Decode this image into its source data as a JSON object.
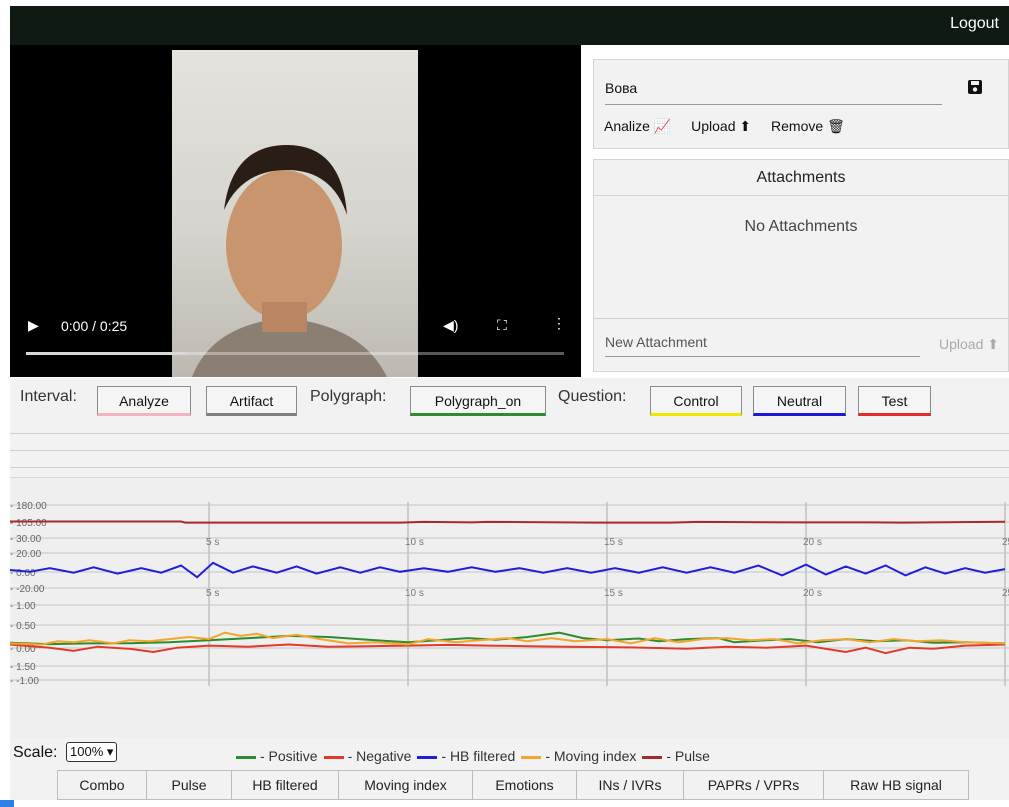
{
  "header": {
    "logout_label": "Logout"
  },
  "video": {
    "time": "0:00 / 0:25",
    "play_icon": "play-icon",
    "volume_icon": "volume-icon",
    "fullscreen_icon": "fullscreen-icon",
    "more_icon": "more-icon"
  },
  "record": {
    "name_value": "Вова",
    "analyze_label": "Analize",
    "upload_label": "Upload",
    "remove_label": "Remove"
  },
  "attachments": {
    "title": "Attachments",
    "empty_text": "No Attachments",
    "new_placeholder": "New Attachment",
    "upload_label": "Upload"
  },
  "toolbar": {
    "interval_label": "Interval:",
    "analyze_btn": "Analyze",
    "artifact_btn": "Artifact",
    "polygraph_label": "Polygraph:",
    "polygraph_btn": "Polygraph_on",
    "question_label": "Question:",
    "control_btn": "Control",
    "neutral_btn": "Neutral",
    "test_btn": "Test"
  },
  "colors": {
    "analyze": "#f3b3c0",
    "artifact": "#808080",
    "polygraph": "#2e8b2e",
    "control": "#f2e600",
    "neutral": "#1a1ad6",
    "test": "#e02b2b",
    "positive": "#2e8b2e",
    "negative": "#e23a2a",
    "hb": "#1f1fd8",
    "moving": "#f4a52a",
    "pulse": "#a52a2a"
  },
  "chart_data": {
    "type": "line",
    "x_ticks": [
      "5 s",
      "10 s",
      "15 s",
      "20 s",
      "25"
    ],
    "xlim": [
      0,
      25
    ],
    "panels": [
      {
        "name": "pulse",
        "y_ticks": [
          "180.00",
          "105.00",
          "30.00"
        ],
        "ylim": [
          30,
          180
        ],
        "series": [
          {
            "name": "Pulse",
            "color": "#a52a2a",
            "points": [
              [
                0,
                105
              ],
              [
                4.3,
                105
              ],
              [
                4.4,
                100
              ],
              [
                9.8,
                100
              ],
              [
                10.4,
                103
              ],
              [
                11.6,
                101
              ],
              [
                12,
                103
              ],
              [
                14.8,
                100
              ],
              [
                16.6,
                100
              ],
              [
                17.3,
                103
              ],
              [
                19.8,
                101
              ],
              [
                21.6,
                101
              ],
              [
                22.4,
                100
              ],
              [
                25,
                104
              ]
            ]
          }
        ]
      },
      {
        "name": "hb",
        "y_ticks": [
          "20.00",
          "0.00",
          "-20.00"
        ],
        "ylim": [
          -20,
          20
        ],
        "series": [
          {
            "name": "HB filtered",
            "color": "#1f1fd8",
            "points": [
              [
                0,
                0
              ],
              [
                0.5,
                -2
              ],
              [
                1,
                2
              ],
              [
                1.6,
                -3
              ],
              [
                2.1,
                3
              ],
              [
                2.7,
                -4
              ],
              [
                3.3,
                2
              ],
              [
                3.8,
                -3
              ],
              [
                4.3,
                5
              ],
              [
                4.7,
                -8
              ],
              [
                5.1,
                8
              ],
              [
                5.6,
                -3
              ],
              [
                6.1,
                4
              ],
              [
                6.7,
                -3
              ],
              [
                7.2,
                4
              ],
              [
                7.7,
                -4
              ],
              [
                8.3,
                3
              ],
              [
                8.8,
                -3
              ],
              [
                9.3,
                3
              ],
              [
                9.8,
                -2
              ],
              [
                10.4,
                2
              ],
              [
                11,
                -2
              ],
              [
                11.6,
                3
              ],
              [
                12.2,
                -2
              ],
              [
                12.8,
                2
              ],
              [
                13.4,
                -3
              ],
              [
                14,
                2
              ],
              [
                14.6,
                -3
              ],
              [
                15.2,
                2
              ],
              [
                15.8,
                -3
              ],
              [
                16.4,
                3
              ],
              [
                17,
                -3
              ],
              [
                17.6,
                3
              ],
              [
                18.2,
                -3
              ],
              [
                18.8,
                5
              ],
              [
                19.4,
                -6
              ],
              [
                20,
                6
              ],
              [
                20.5,
                -5
              ],
              [
                21,
                4
              ],
              [
                21.5,
                -4
              ],
              [
                22,
                5
              ],
              [
                22.5,
                -6
              ],
              [
                23,
                3
              ],
              [
                23.5,
                -4
              ],
              [
                24,
                2
              ],
              [
                24.5,
                -3
              ],
              [
                25,
                1
              ]
            ]
          }
        ]
      },
      {
        "name": "emotions",
        "y_ticks": [
          "1.00",
          "0.50",
          "0.00",
          "1.50",
          "-1.00"
        ],
        "ylim": [
          -1,
          1
        ],
        "series": [
          {
            "name": "Positive",
            "color": "#2e8b2e",
            "points": [
              [
                0,
                0.08
              ],
              [
                1,
                0.02
              ],
              [
                2,
                0.05
              ],
              [
                3,
                0.06
              ],
              [
                4,
                0.1
              ],
              [
                5,
                0.2
              ],
              [
                6,
                0.3
              ],
              [
                7,
                0.4
              ],
              [
                8,
                0.35
              ],
              [
                9,
                0.22
              ],
              [
                10,
                0.1
              ],
              [
                10.6,
                0.18
              ],
              [
                11.5,
                0.3
              ],
              [
                12.2,
                0.22
              ],
              [
                13,
                0.35
              ],
              [
                13.8,
                0.55
              ],
              [
                14.4,
                0.3
              ],
              [
                15,
                0.2
              ],
              [
                15.8,
                0.28
              ],
              [
                16.3,
                0.15
              ],
              [
                17,
                0.25
              ],
              [
                17.8,
                0.3
              ],
              [
                18.2,
                0.1
              ],
              [
                19,
                0.2
              ],
              [
                19.6,
                0.25
              ],
              [
                20.3,
                0.1
              ],
              [
                21,
                0.25
              ],
              [
                21.8,
                0.15
              ],
              [
                22.5,
                0.2
              ],
              [
                23.2,
                0.08
              ],
              [
                24,
                0.1
              ],
              [
                25,
                0.05
              ]
            ]
          },
          {
            "name": "Negative",
            "color": "#e23a2a",
            "points": [
              [
                0,
                0
              ],
              [
                1,
                -0.15
              ],
              [
                1.6,
                -0.3
              ],
              [
                2.2,
                -0.1
              ],
              [
                3,
                -0.2
              ],
              [
                3.6,
                -0.35
              ],
              [
                4.2,
                -0.15
              ],
              [
                5,
                -0.05
              ],
              [
                6,
                -0.1
              ],
              [
                7,
                0
              ],
              [
                8,
                -0.1
              ],
              [
                9,
                -0.08
              ],
              [
                10,
                -0.05
              ],
              [
                11,
                -0.02
              ],
              [
                12,
                -0.05
              ],
              [
                13,
                -0.08
              ],
              [
                14,
                -0.1
              ],
              [
                15,
                -0.12
              ],
              [
                16,
                -0.15
              ],
              [
                17,
                -0.2
              ],
              [
                18,
                -0.1
              ],
              [
                19,
                -0.15
              ],
              [
                20,
                -0.05
              ],
              [
                21,
                -0.35
              ],
              [
                21.5,
                -0.15
              ],
              [
                22,
                -0.4
              ],
              [
                22.6,
                -0.15
              ],
              [
                23.2,
                -0.2
              ],
              [
                24,
                -0.05
              ],
              [
                25,
                0
              ]
            ]
          },
          {
            "name": "Moving index",
            "color": "#f4a52a",
            "points": [
              [
                0,
                0.05
              ],
              [
                0.8,
                0
              ],
              [
                1.2,
                0.15
              ],
              [
                1.6,
                0.1
              ],
              [
                2,
                0.2
              ],
              [
                2.6,
                0.05
              ],
              [
                3,
                0.2
              ],
              [
                3.5,
                0.15
              ],
              [
                4,
                0.25
              ],
              [
                4.5,
                0.35
              ],
              [
                5,
                0.25
              ],
              [
                5.4,
                0.55
              ],
              [
                5.8,
                0.4
              ],
              [
                6.2,
                0.5
              ],
              [
                6.6,
                0.3
              ],
              [
                7.2,
                0.45
              ],
              [
                7.8,
                0.25
              ],
              [
                8.5,
                0.05
              ],
              [
                9.2,
                0.1
              ],
              [
                10,
                0
              ],
              [
                10.5,
                0.25
              ],
              [
                11.2,
                0.1
              ],
              [
                11.8,
                0.2
              ],
              [
                12.5,
                0.3
              ],
              [
                13,
                0.15
              ],
              [
                13.6,
                0.3
              ],
              [
                14.2,
                0.15
              ],
              [
                15,
                0.25
              ],
              [
                15.6,
                0.05
              ],
              [
                16.2,
                0.3
              ],
              [
                16.8,
                0.1
              ],
              [
                17.4,
                0.25
              ],
              [
                18,
                0.3
              ],
              [
                18.6,
                0.2
              ],
              [
                19.2,
                0.25
              ],
              [
                19.8,
                0.05
              ],
              [
                20.4,
                0.2
              ],
              [
                21,
                0.25
              ],
              [
                21.6,
                0.1
              ],
              [
                22.2,
                0.25
              ],
              [
                22.8,
                0.15
              ],
              [
                23.4,
                0.2
              ],
              [
                24,
                0.1
              ],
              [
                25,
                0.05
              ]
            ]
          }
        ]
      }
    ],
    "legend": [
      "Positive",
      "Negative",
      "HB filtered",
      "Moving index",
      "Pulse"
    ]
  },
  "bottom": {
    "scale_label": "Scale:",
    "scale_value": "100% ▾",
    "legend": [
      {
        "label": "- Positive",
        "color": "#2e8b2e"
      },
      {
        "label": "- Negative",
        "color": "#e23a2a"
      },
      {
        "label": "- HB filtered",
        "color": "#1f1fd8"
      },
      {
        "label": "- Moving index",
        "color": "#f4a52a"
      },
      {
        "label": "- Pulse",
        "color": "#a52a2a"
      }
    ],
    "tabs": [
      "Combo",
      "Pulse",
      "HB filtered",
      "Moving index",
      "Emotions",
      "INs / IVRs",
      "PAPRs / VPRs",
      "Raw HB signal"
    ]
  }
}
